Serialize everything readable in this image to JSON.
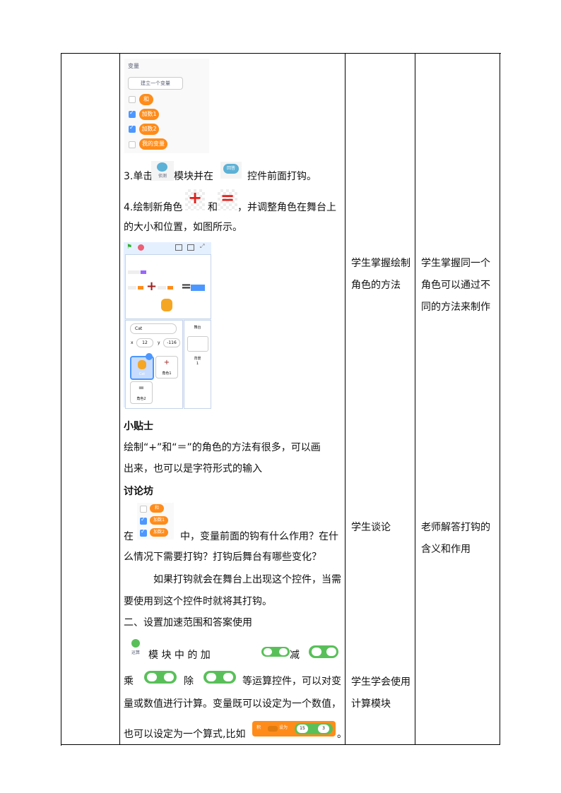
{
  "variables_panel": {
    "title": "变量",
    "create_button": "建立一个变量",
    "items": [
      {
        "label": "和",
        "checked": false
      },
      {
        "label": "加数1",
        "checked": true
      },
      {
        "label": "加数2",
        "checked": true
      },
      {
        "label": "我的变量",
        "checked": false
      }
    ]
  },
  "steps": {
    "step3_a": "3.单击",
    "sensing_label": "侦测",
    "step3_b": "模块并在",
    "answer_label": "回答",
    "step3_c": "控件前面打钩。",
    "step4_a": "4.绘制新角色",
    "plus_glyph": "+",
    "step4_and": "和",
    "equals_glyph": "=",
    "step4_b": "，并调整角色在舞台上",
    "step4_c": "的大小和位置，如图所示。"
  },
  "stage_shot": {
    "sprite_name": "Cat",
    "x_label": "x",
    "x_value": "12",
    "y_label": "y",
    "y_value": "-116",
    "stage_label": "舞台",
    "backdrop_label": "背景",
    "backdrop_count": "1",
    "sprite_cat": "Cat",
    "sprite1": "角色1",
    "sprite2": "角色2"
  },
  "tips": {
    "heading": "小贴士",
    "line1": "绘制“+”和“＝”的角色的方法有很多，可以画",
    "line2": "出来，也可以是字符形式的输入"
  },
  "discussion": {
    "heading": "讨论坊",
    "in_label": "在",
    "q_line1": "中，变量前面的钩有什么作用？在什",
    "q_line2": "么情况下需要打钩？打钩后舞台有哪些变化？",
    "a_line1": "如果打钩就会在舞台上出现这个控件，当需",
    "a_line2": "要使用到这个控件时就将其打钩。",
    "mini_items": [
      "和",
      "加数1",
      "加数2"
    ]
  },
  "section2": {
    "title": "二、设置加速范围和答案使用",
    "operators_label": "运算",
    "line1_a": "模 块 中 的 加",
    "line1_b": "减",
    "line2_a": "乘",
    "line2_b": "除",
    "line2_c": "等运算控件，可以对变",
    "line3": "量或数值进行计算。变量既可以设定为一个数值，",
    "line4": "也可以设定为一个算式,比如",
    "line4_end": "。",
    "set_block": {
      "set": "设为",
      "var": "积",
      "n1": "15",
      "n2": "3"
    }
  },
  "column_student": {
    "row1": "学生掌握绘制角色的方法",
    "row2": "学生谈论",
    "row3": "学生学会使用计算模块"
  },
  "column_teacher": {
    "row1": "学生掌握同一个角色可以通过不同的方法来制作",
    "row2": "老师解答打钩的含义和作用"
  }
}
